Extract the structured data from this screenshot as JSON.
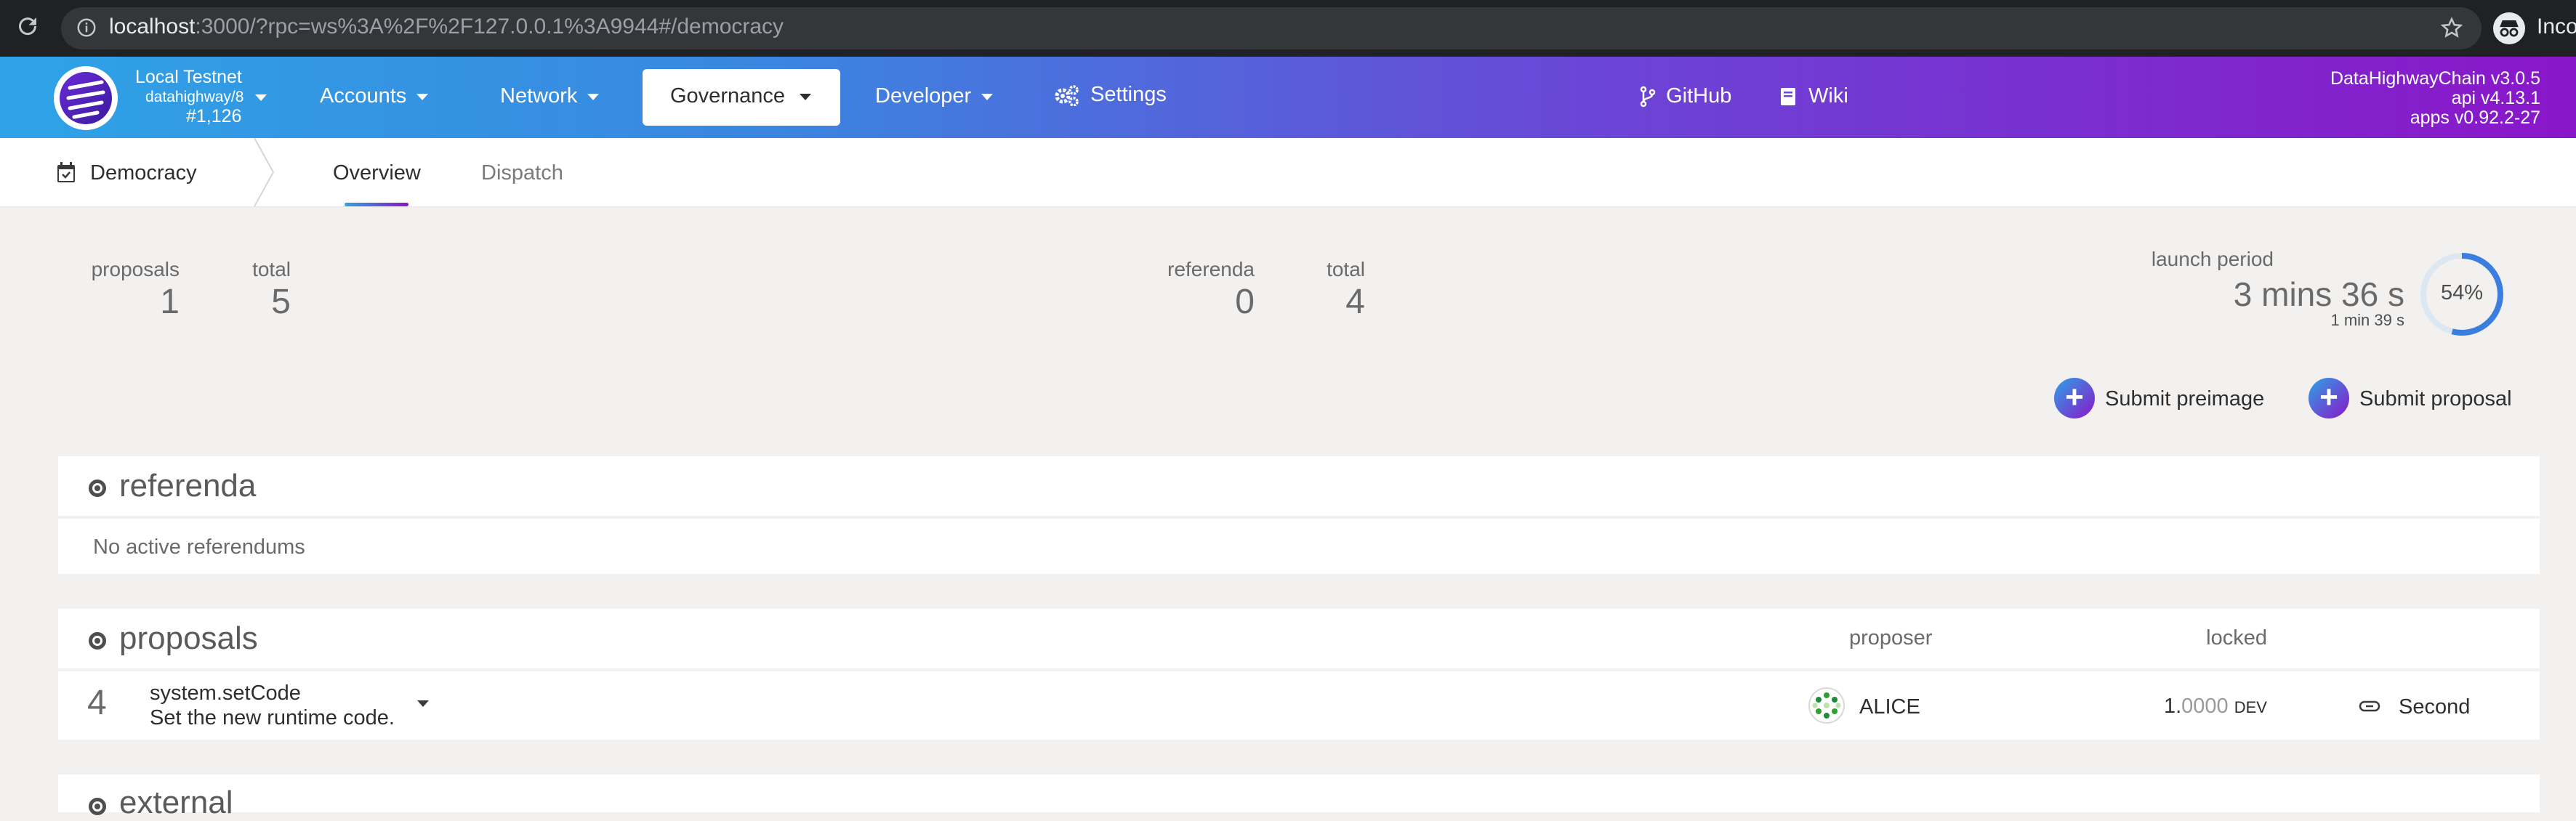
{
  "browser": {
    "url_host": "localhost",
    "url_rest": ":3000/?rpc=ws%3A%2F%2F127.0.0.1%3A9944#/democracy",
    "incognito_label": "Incognito",
    "refresh_icon": "refresh-icon",
    "info_icon": "info-icon",
    "star_icon": "star-icon",
    "incognito_icon": "incognito-icon"
  },
  "header": {
    "chain_name": "Local Testnet",
    "runtime": "datahighway/8",
    "block": "#1,126",
    "nav": {
      "accounts": "Accounts",
      "network": "Network",
      "governance": "Governance",
      "developer": "Developer",
      "settings": "Settings",
      "github": "GitHub",
      "wiki": "Wiki"
    },
    "version": {
      "chain": "DataHighwayChain v3.0.5",
      "api": "api v4.13.1",
      "apps": "apps v0.92.2-27"
    },
    "colors": {
      "gradient_start": "#2ea3e6",
      "gradient_end": "#8a16c9"
    }
  },
  "subnav": {
    "section": "Democracy",
    "tabs": {
      "overview": "Overview",
      "dispatch": "Dispatch"
    },
    "active_tab": "Overview"
  },
  "summary": {
    "proposals_label": "proposals",
    "proposals_value": "1",
    "proposals_total_label": "total",
    "proposals_total_value": "5",
    "referenda_label": "referenda",
    "referenda_value": "0",
    "referenda_total_label": "total",
    "referenda_total_value": "4",
    "launch_period_label": "launch period",
    "launch_main": "3 mins 36 s",
    "launch_sub": "1 min 39 s",
    "launch_percent_text": "54%",
    "launch_fraction": 0.54
  },
  "actions": {
    "submit_preimage": "Submit preimage",
    "submit_proposal": "Submit proposal"
  },
  "referenda": {
    "title": "referenda",
    "empty": "No active referendums"
  },
  "proposals": {
    "title": "proposals",
    "col_proposer": "proposer",
    "col_locked": "locked",
    "rows": [
      {
        "index": "4",
        "method": "system.setCode",
        "description": "Set the new runtime code.",
        "proposer": "ALICE",
        "locked_int": "1.",
        "locked_dec": "0000",
        "locked_unit": "DEV",
        "action": "Second"
      }
    ]
  },
  "external": {
    "title": "external"
  }
}
